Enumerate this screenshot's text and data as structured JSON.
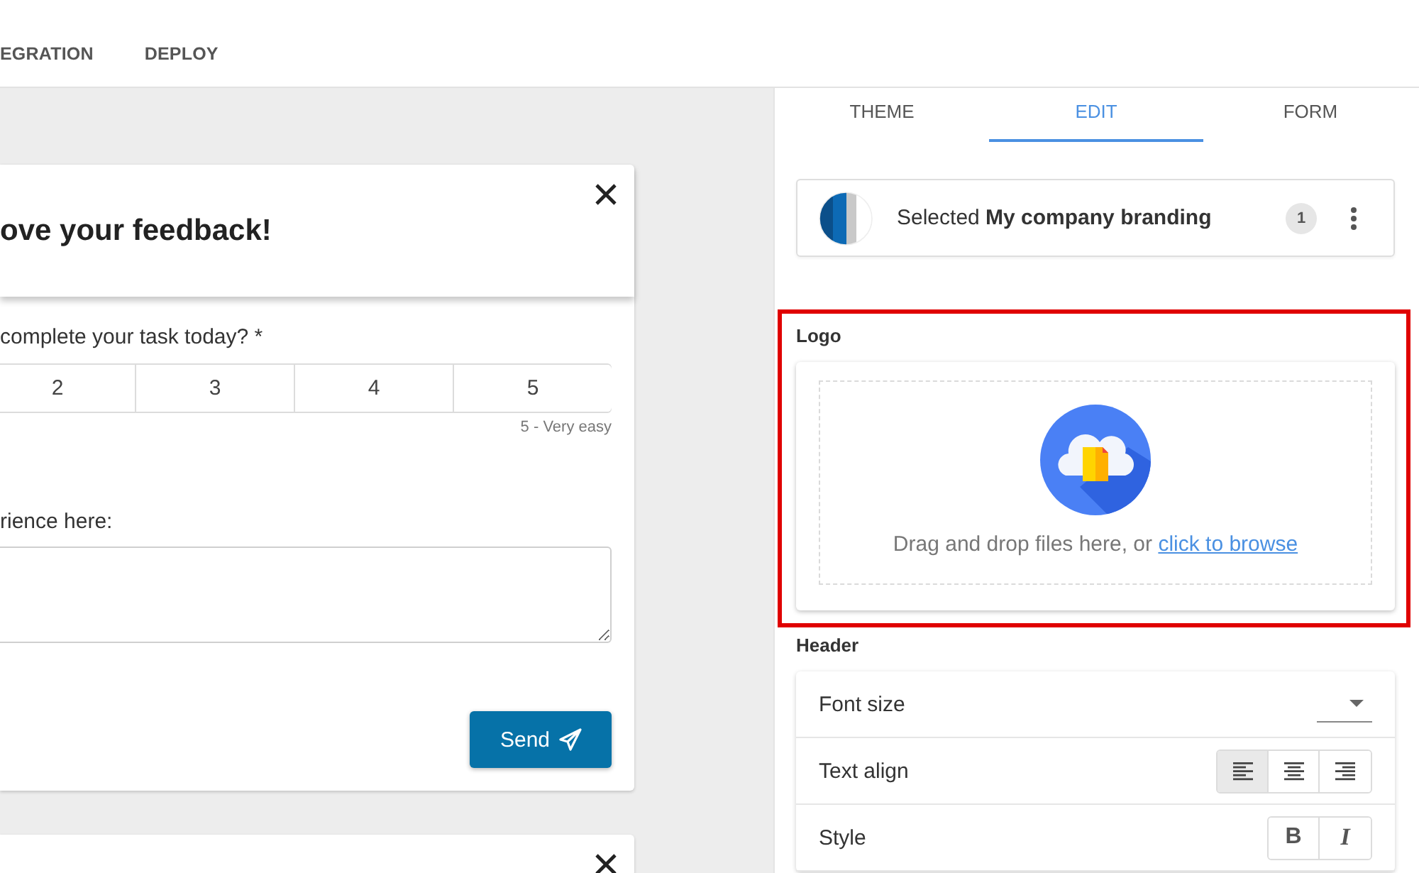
{
  "top_nav": {
    "tabs": [
      {
        "label": "EGRATION",
        "selected": false
      },
      {
        "label": "DEPLOY",
        "selected": false
      }
    ]
  },
  "preview": {
    "cards": [
      {
        "kind": "survey",
        "title": "ove your feedback!",
        "question": "complete your task today? *",
        "rating": {
          "options": [
            {
              "label": "2",
              "selected": false
            },
            {
              "label": "3",
              "selected": false
            },
            {
              "label": "4",
              "selected": false
            },
            {
              "label": "5",
              "selected": false
            }
          ],
          "hint": "5 - Very easy"
        },
        "comment_label": "rience here:",
        "send_button": "Send"
      },
      {
        "kind": "stub"
      }
    ]
  },
  "settings_panel": {
    "tabs": [
      {
        "label": "THEME",
        "selected": false
      },
      {
        "label": "EDIT",
        "selected": true
      },
      {
        "label": "FORM",
        "selected": false
      }
    ],
    "theme_card": {
      "text": "Selected **My company branding**",
      "count": "1"
    },
    "logo_section": {
      "label": "Logo",
      "highlighted": true,
      "upload_text": "Drag and drop files here, or",
      "upload_link": "click to browse"
    },
    "header_section": {
      "label": "Header",
      "rows": [
        {
          "kind": "dropdown",
          "label": "Font size"
        },
        {
          "kind": "align",
          "label": "Text align",
          "options": [
            {
              "kind": "left",
              "selected": true
            },
            {
              "kind": "center",
              "selected": false
            },
            {
              "kind": "right",
              "selected": false
            }
          ]
        },
        {
          "kind": "style",
          "label": "Style",
          "options": [
            {
              "kind": "bold",
              "label": "B",
              "selected": false
            },
            {
              "kind": "italic",
              "label": "I",
              "selected": false
            }
          ]
        }
      ]
    }
  }
}
